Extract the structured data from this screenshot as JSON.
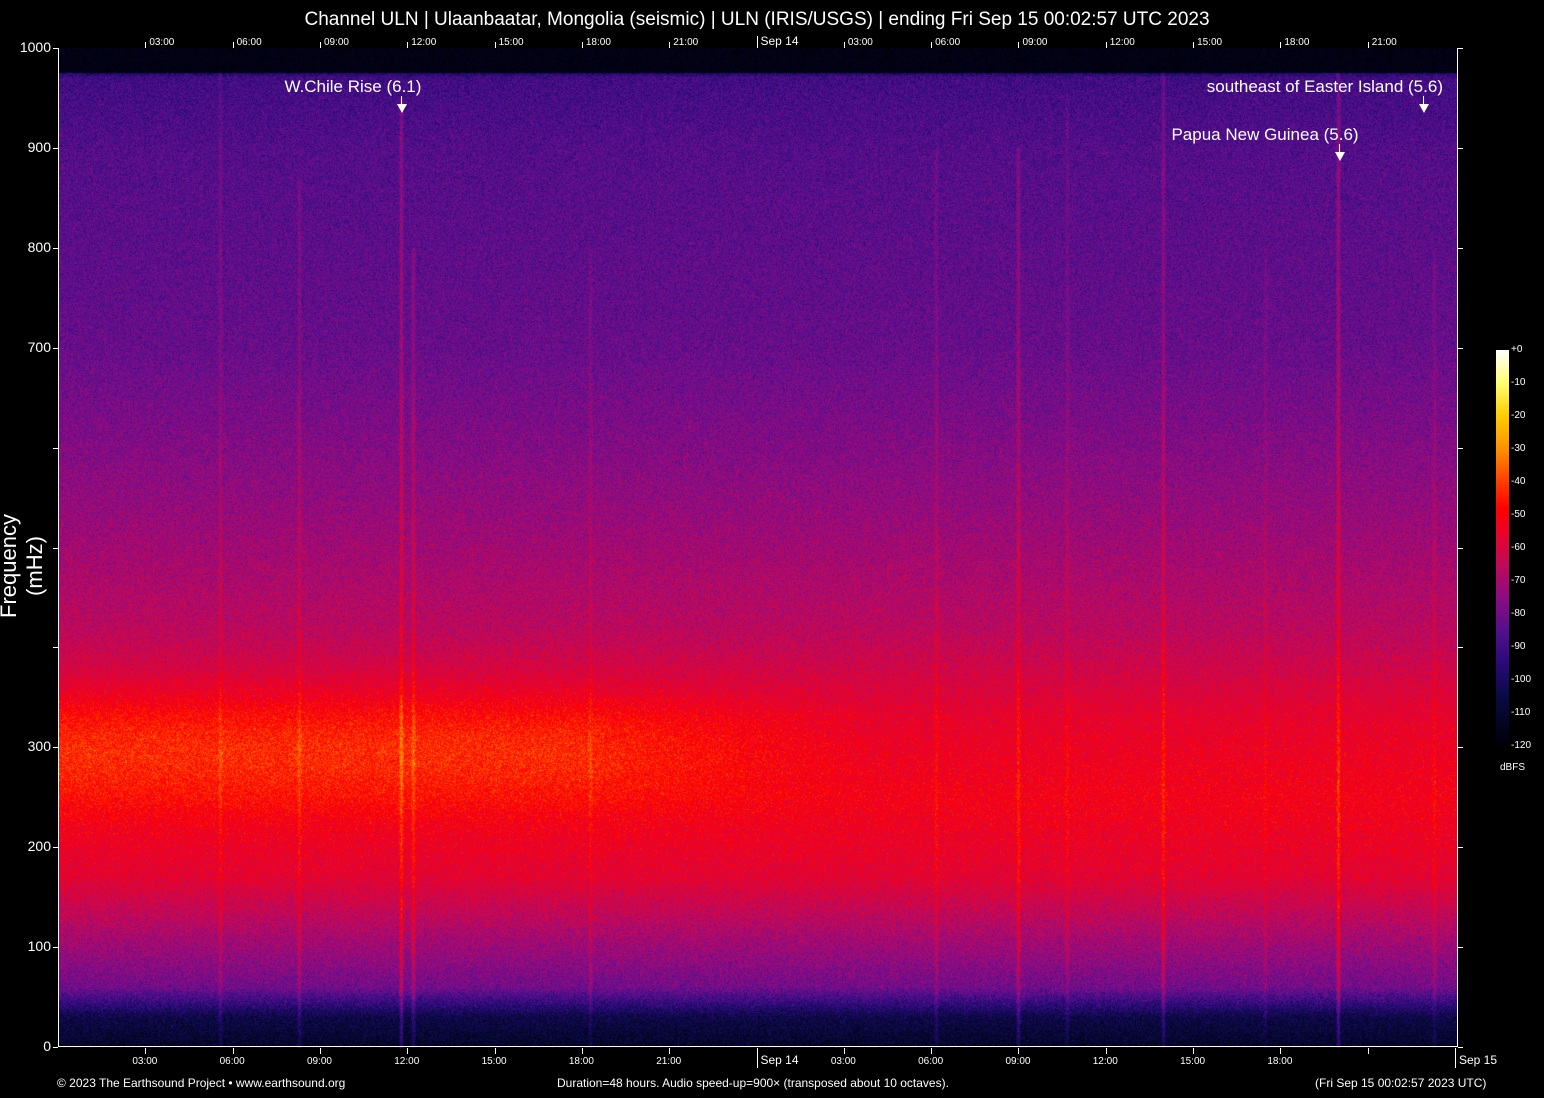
{
  "chart_data": {
    "type": "heatmap",
    "title": "Channel ULN | Ulaanbaatar, Mongolia (seismic) | ULN (IRIS/USGS) | ending Fri Sep 15 00:02:57 UTC 2023",
    "ylabel": "Frequency (mHz)",
    "xlabel": "",
    "xlim_hours": [
      0,
      48
    ],
    "ylim": [
      0,
      1000
    ],
    "y_ticks": [
      0,
      100,
      200,
      300,
      400,
      500,
      600,
      700,
      800,
      900,
      1000
    ],
    "y_tick_labels": [
      "0",
      "100",
      "200",
      "300",
      "",
      "",
      "",
      "700",
      "800",
      "900",
      "1000"
    ],
    "x_ticks_top": [
      {
        "hour": 3,
        "label": "03:00"
      },
      {
        "hour": 6,
        "label": "06:00"
      },
      {
        "hour": 9,
        "label": "09:00"
      },
      {
        "hour": 12,
        "label": "12:00"
      },
      {
        "hour": 15,
        "label": "15:00"
      },
      {
        "hour": 18,
        "label": "18:00"
      },
      {
        "hour": 21,
        "label": "21:00"
      },
      {
        "hour": 24,
        "label": "Sep 14"
      },
      {
        "hour": 27,
        "label": "03:00"
      },
      {
        "hour": 30,
        "label": "06:00"
      },
      {
        "hour": 33,
        "label": "09:00"
      },
      {
        "hour": 36,
        "label": "12:00"
      },
      {
        "hour": 39,
        "label": "15:00"
      },
      {
        "hour": 42,
        "label": "18:00"
      },
      {
        "hour": 45,
        "label": "21:00"
      }
    ],
    "x_ticks_bottom": [
      {
        "hour": 3,
        "label": "03:00"
      },
      {
        "hour": 6,
        "label": "06:00"
      },
      {
        "hour": 9,
        "label": "09:00"
      },
      {
        "hour": 12,
        "label": "12:00"
      },
      {
        "hour": 15,
        "label": "15:00"
      },
      {
        "hour": 18,
        "label": "18:00"
      },
      {
        "hour": 21,
        "label": "21:00"
      },
      {
        "hour": 24,
        "label": "Sep 14"
      },
      {
        "hour": 27,
        "label": "03:00"
      },
      {
        "hour": 30,
        "label": "06:00"
      },
      {
        "hour": 33,
        "label": "09:00"
      },
      {
        "hour": 36,
        "label": "12:00"
      },
      {
        "hour": 39,
        "label": "15:00"
      },
      {
        "hour": 42,
        "label": "18:00"
      },
      {
        "hour": 45,
        "label": ""
      },
      {
        "hour": 48,
        "label": "Sep 15"
      }
    ],
    "events": [
      {
        "label": "W.Chile Rise (6.1)",
        "hour": 11.8,
        "row": 1
      },
      {
        "label": "Papua New Guinea (5.6)",
        "hour": 44.0,
        "row": 2
      },
      {
        "label": "southeast of Easter Island (5.6)",
        "hour": 46.9,
        "row": 1
      }
    ],
    "colorbar": {
      "unit": "dBFS",
      "range": [
        -120,
        0
      ],
      "tick_labels": [
        "+0",
        "-10",
        "-20",
        "-30",
        "-40",
        "-50",
        "-60",
        "-70",
        "-80",
        "-90",
        "-100",
        "-110",
        "-120"
      ],
      "stops": [
        {
          "db": -120,
          "color": "#000008"
        },
        {
          "db": -105,
          "color": "#0a0a45"
        },
        {
          "db": -95,
          "color": "#2a0a78"
        },
        {
          "db": -85,
          "color": "#55108e"
        },
        {
          "db": -75,
          "color": "#8c0c84"
        },
        {
          "db": -65,
          "color": "#c00a5a"
        },
        {
          "db": -55,
          "color": "#ec0328"
        },
        {
          "db": -48,
          "color": "#ff0000"
        },
        {
          "db": -40,
          "color": "#ff3c00"
        },
        {
          "db": -30,
          "color": "#ff9000"
        },
        {
          "db": -20,
          "color": "#ffcc00"
        },
        {
          "db": -10,
          "color": "#ffff70"
        },
        {
          "db": 0,
          "color": "#ffffff"
        }
      ]
    },
    "series_profile": [
      {
        "freq": 0,
        "db": -112
      },
      {
        "freq": 30,
        "db": -105
      },
      {
        "freq": 60,
        "db": -80
      },
      {
        "freq": 110,
        "db": -70
      },
      {
        "freq": 170,
        "db": -57
      },
      {
        "freq": 250,
        "db": -52
      },
      {
        "freq": 330,
        "db": -56
      },
      {
        "freq": 420,
        "db": -66
      },
      {
        "freq": 550,
        "db": -74
      },
      {
        "freq": 700,
        "db": -82
      },
      {
        "freq": 900,
        "db": -86
      },
      {
        "freq": 970,
        "db": -90
      },
      {
        "freq": 985,
        "db": -120
      },
      {
        "freq": 1000,
        "db": -120
      }
    ]
  },
  "footer": {
    "copyright": "© 2023 The Earthsound Project • www.earthsound.org",
    "info": "Duration=48 hours. Audio speed-up=900× (transposed about 10 octaves).",
    "end_time": "(Fri Sep 15 00:02:57 2023 UTC)"
  }
}
